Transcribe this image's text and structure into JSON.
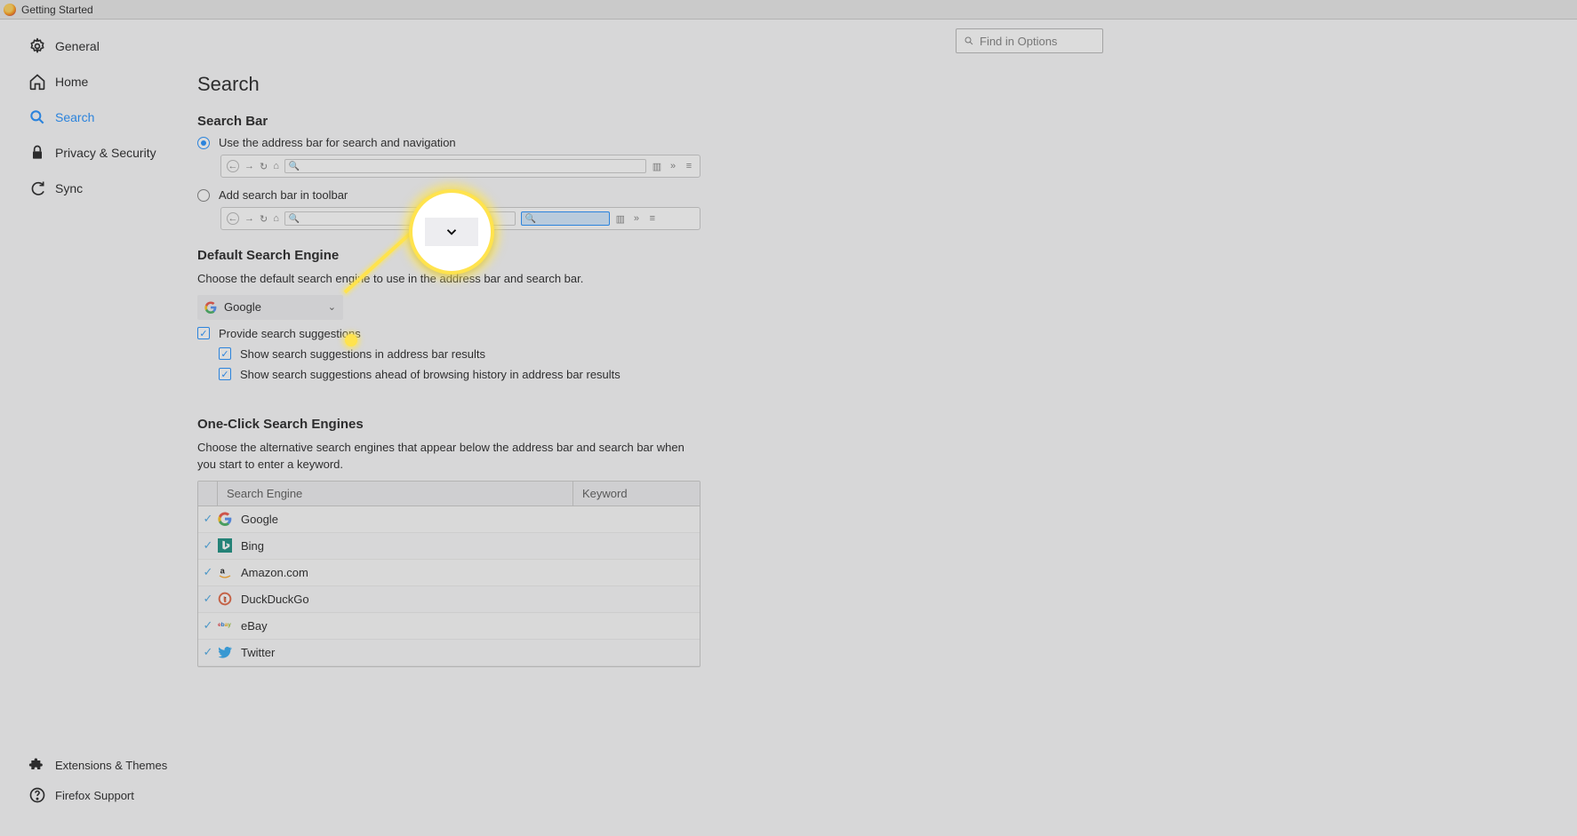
{
  "tab_title": "Getting Started",
  "find_placeholder": "Find in Options",
  "sidebar": {
    "items": [
      {
        "label": "General"
      },
      {
        "label": "Home"
      },
      {
        "label": "Search"
      },
      {
        "label": "Privacy & Security"
      },
      {
        "label": "Sync"
      }
    ],
    "bottom": [
      {
        "label": "Extensions & Themes"
      },
      {
        "label": "Firefox Support"
      }
    ]
  },
  "page": {
    "title": "Search",
    "search_bar": {
      "heading": "Search Bar",
      "option1": "Use the address bar for search and navigation",
      "option2": "Add search bar in toolbar"
    },
    "default_engine": {
      "heading": "Default Search Engine",
      "desc": "Choose the default search engine to use in the address bar and search bar.",
      "selected": "Google",
      "suggestions_label": "Provide search suggestions",
      "sub1": "Show search suggestions in address bar results",
      "sub2": "Show search suggestions ahead of browsing history in address bar results"
    },
    "one_click": {
      "heading": "One-Click Search Engines",
      "desc": "Choose the alternative search engines that appear below the address bar and search bar when you start to enter a keyword.",
      "columns": {
        "engine": "Search Engine",
        "keyword": "Keyword"
      },
      "rows": [
        {
          "name": "Google",
          "icon": "google",
          "checked": true
        },
        {
          "name": "Bing",
          "icon": "bing",
          "checked": true
        },
        {
          "name": "Amazon.com",
          "icon": "amazon",
          "checked": true
        },
        {
          "name": "DuckDuckGo",
          "icon": "duckduckgo",
          "checked": true
        },
        {
          "name": "eBay",
          "icon": "ebay",
          "checked": true
        },
        {
          "name": "Twitter",
          "icon": "twitter",
          "checked": true
        }
      ]
    }
  }
}
